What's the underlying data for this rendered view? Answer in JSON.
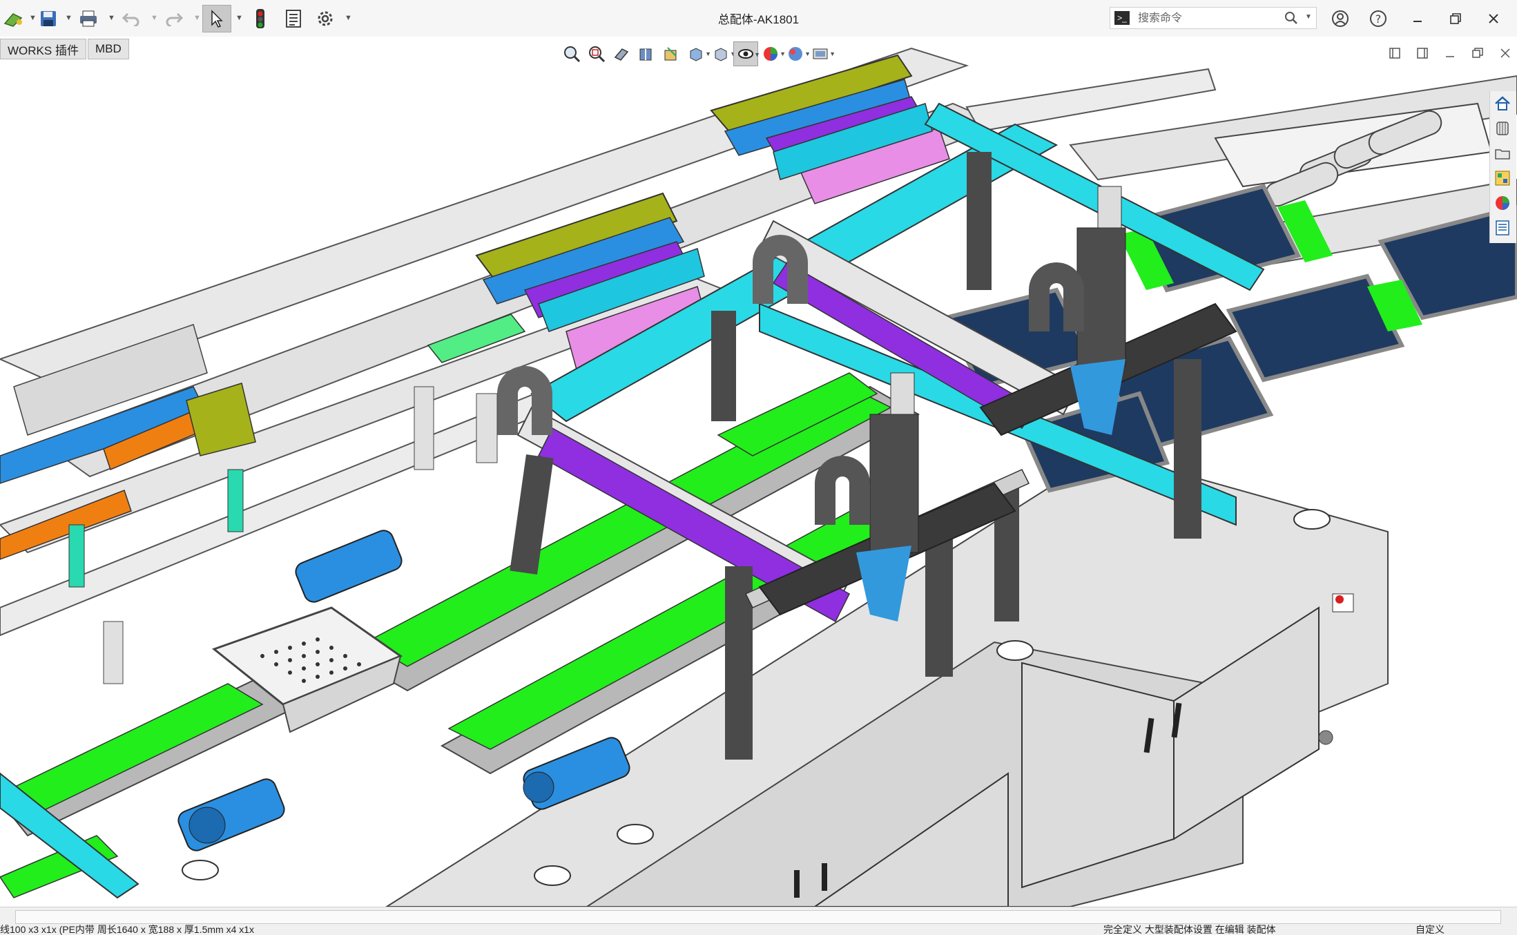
{
  "window": {
    "title": "总配体-AK1801",
    "search_placeholder": "搜索命令"
  },
  "tabs": [
    {
      "label": "WORKS 插件"
    },
    {
      "label": "MBD"
    }
  ],
  "icons": {
    "titlebar": [
      "new-file-icon",
      "save-icon",
      "print-icon",
      "undo-icon",
      "redo-icon",
      "select-cursor-icon",
      "rebuild-traffic-light-icon",
      "file-properties-icon",
      "options-gear-icon"
    ],
    "headsup": [
      "zoom-to-fit-icon",
      "zoom-to-area-icon",
      "previous-view-icon",
      "section-view-icon",
      "dynamic-annotation-icon",
      "view-orientation-icon",
      "display-style-icon",
      "hide-show-items-icon",
      "edit-appearance-icon",
      "apply-scene-icon",
      "view-settings-icon"
    ],
    "taskpane": [
      "home-icon",
      "design-library-icon",
      "file-explorer-icon",
      "view-palette-icon",
      "appearances-icon",
      "custom-properties-icon"
    ]
  },
  "status": {
    "left": "线100 x3 x1x (PE内带 周长1640 x 宽188 x 厚1.5mm x4 x1x",
    "middle": "完全定义   大型装配体设置   在编辑 装配体",
    "right": "自定义"
  },
  "colors": {
    "conveyor_green": "#22ee1b",
    "rail_cyan": "#29d9e6",
    "purple": "#8f2fe0",
    "olive": "#a6b21a",
    "orange": "#f07f12",
    "motor_blue": "#2a8fe0",
    "pink": "#e88ee6",
    "dark_gray": "#4a4a4a",
    "frame_gray": "#dcdcdc",
    "tray_navy": "#1f3a60"
  }
}
